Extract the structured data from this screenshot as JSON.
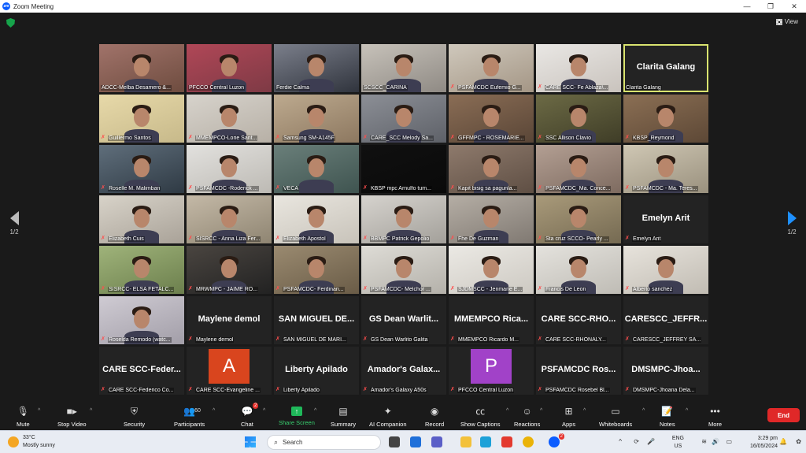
{
  "window": {
    "title": "Zoom Meeting",
    "minimize": "—",
    "maximize": "❐",
    "close": "✕"
  },
  "topbar": {
    "view_label": "View"
  },
  "pager": {
    "left": "1/2",
    "right": "1/2"
  },
  "tiles": [
    {
      "name": "ADCC-Melba Desamero &...",
      "kind": "video",
      "muted": false,
      "colors": [
        "#a1736a",
        "#6e4c3f"
      ]
    },
    {
      "name": "PFCCO Central Luzon",
      "kind": "video",
      "muted": false,
      "colors": [
        "#b04757",
        "#7e3a45"
      ]
    },
    {
      "name": "Ferdie Calma",
      "kind": "video",
      "muted": false,
      "colors": [
        "#7b7f8b",
        "#30343d"
      ]
    },
    {
      "name": "SCSCC_CARINA",
      "kind": "video",
      "muted": false,
      "colors": [
        "#c7c2ba",
        "#8f8a84"
      ]
    },
    {
      "name": "PSFAMCDC Eufemio G...",
      "kind": "video",
      "muted": true,
      "colors": [
        "#cfc8bc",
        "#a49685"
      ]
    },
    {
      "name": "CARE SCC- Fe Ablaza\\...",
      "kind": "video",
      "muted": true,
      "colors": [
        "#e9e7e4",
        "#c9c3bd"
      ]
    },
    {
      "name": "Clarita Galang",
      "kind": "name",
      "muted": false,
      "active": true
    },
    {
      "name": "Guillermo Santos",
      "kind": "video",
      "muted": true,
      "colors": [
        "#e7d9a9",
        "#c7b98a"
      ]
    },
    {
      "name": "MMEMPCO-Lorie Sant...",
      "kind": "video",
      "muted": true,
      "colors": [
        "#d7d3cc",
        "#b7b0a6"
      ]
    },
    {
      "name": "Samsung SM-A145F",
      "kind": "video",
      "muted": true,
      "colors": [
        "#bdaa8f",
        "#8d7860"
      ]
    },
    {
      "name": "CARE_SCC Melody Sa...",
      "kind": "video",
      "muted": true,
      "colors": [
        "#8c8f96",
        "#5e6168"
      ]
    },
    {
      "name": "GFFMPC - ROSEMARIE...",
      "kind": "video",
      "muted": true,
      "colors": [
        "#8a6d55",
        "#5a4637"
      ]
    },
    {
      "name": "SSC Allison Clavio",
      "kind": "video",
      "muted": true,
      "colors": [
        "#6c6a45",
        "#3f3d27"
      ]
    },
    {
      "name": "KBSP_Reymond",
      "kind": "video",
      "muted": true,
      "colors": [
        "#8b6f54",
        "#5d4836"
      ]
    },
    {
      "name": "Roselle M. Malimban",
      "kind": "video",
      "muted": true,
      "colors": [
        "#5f6e7b",
        "#2f3a44"
      ]
    },
    {
      "name": "PSFAMCDC -Roderick ...",
      "kind": "video",
      "muted": true,
      "colors": [
        "#e2e1de",
        "#bdbab4"
      ]
    },
    {
      "name": "VECA",
      "kind": "video",
      "muted": true,
      "colors": [
        "#6a7f7a",
        "#3f5450"
      ]
    },
    {
      "name": "KBSP mpc Arnulfo tum...",
      "kind": "video",
      "muted": true,
      "colors": [
        "#101010",
        "#0a0a0a"
      ]
    },
    {
      "name": "Kapit bisig sa pagunlа...",
      "kind": "video",
      "muted": true,
      "colors": [
        "#8e7a6c",
        "#5f4f44"
      ]
    },
    {
      "name": "PSFAMCDC_Ma. Conce...",
      "kind": "video",
      "muted": true,
      "colors": [
        "#b39f93",
        "#7e6b60"
      ]
    },
    {
      "name": "PSFAMCDC - Ma. Teres...",
      "kind": "video",
      "muted": true,
      "colors": [
        "#cfc7b4",
        "#9a917e"
      ]
    },
    {
      "name": "Elizabeth Cuis",
      "kind": "video",
      "muted": true,
      "colors": [
        "#d8d3c9",
        "#a9a298"
      ]
    },
    {
      "name": "SISRCC - Anna Liza Fer...",
      "kind": "video",
      "muted": true,
      "colors": [
        "#c4b9a7",
        "#8f8572"
      ]
    },
    {
      "name": "Elizabeth Apostol",
      "kind": "video",
      "muted": true,
      "colors": [
        "#e9e6df",
        "#c8c3ba"
      ]
    },
    {
      "name": "BBMPC Patrick Gepolio",
      "kind": "video",
      "muted": true,
      "colors": [
        "#d6d3ce",
        "#a3a09a"
      ]
    },
    {
      "name": "Fhe De Guzman",
      "kind": "video",
      "muted": true,
      "colors": [
        "#b5aea5",
        "#807972"
      ]
    },
    {
      "name": "Sta cruz SCCO- Pearly ...",
      "kind": "video",
      "muted": true,
      "colors": [
        "#a99a7a",
        "#756a52"
      ]
    },
    {
      "name": "Emelyn Arit",
      "kind": "name",
      "muted": true
    },
    {
      "name": "SISRCC- ELSA FETALC...",
      "kind": "video",
      "muted": true,
      "colors": [
        "#9fb37a",
        "#6c7f4d"
      ]
    },
    {
      "name": "MRWMPC - JAIME RO...",
      "kind": "video",
      "muted": true,
      "colors": [
        "#4a4540",
        "#222"
      ]
    },
    {
      "name": "PSFAMCDC- Ferdinan...",
      "kind": "video",
      "muted": true,
      "colors": [
        "#9a8a70",
        "#6a5c47"
      ]
    },
    {
      "name": "PSFAMCDC- Melchor ...",
      "kind": "video",
      "muted": true,
      "colors": [
        "#dedcd6",
        "#b4b1aa"
      ]
    },
    {
      "name": "SJDMSCC - Jenmarie E...",
      "kind": "video",
      "muted": true,
      "colors": [
        "#ebe9e4",
        "#cdc9c2"
      ]
    },
    {
      "name": "Francis De Leon",
      "kind": "video",
      "muted": true,
      "colors": [
        "#e4e2dd",
        "#bfbcb5"
      ]
    },
    {
      "name": "Alberto sanchez",
      "kind": "video",
      "muted": true,
      "colors": [
        "#e7e3dc",
        "#c1bcb3"
      ]
    },
    {
      "name": "Roselda Remodo (watc...",
      "kind": "video",
      "muted": true,
      "colors": [
        "#cfcbd3",
        "#a29ea8"
      ]
    },
    {
      "name": "Maylene demol",
      "kind": "name",
      "muted": true,
      "big": "Maylene demol"
    },
    {
      "name": "SAN MIGUEL DE MARI...",
      "kind": "name",
      "muted": true,
      "big": "SAN MIGUEL DE..."
    },
    {
      "name": "GS Dean Warlito Galita",
      "kind": "name",
      "muted": true,
      "big": "GS Dean Warlit..."
    },
    {
      "name": "MMEMPCO Ricardo M...",
      "kind": "name",
      "muted": true,
      "big": "MMEMPCO Rica..."
    },
    {
      "name": "CARE SCC-RHONALY...",
      "kind": "name",
      "muted": true,
      "big": "CARE SCC-RHO..."
    },
    {
      "name": "CARESCC_JEFFREY SA...",
      "kind": "name",
      "muted": true,
      "big": "CARESCC_JEFFR..."
    },
    {
      "name": "CARE SCC-Federico Co...",
      "kind": "name",
      "muted": true,
      "big": "CARE SCC-Feder..."
    },
    {
      "name": "CARE SCC-Evangeline ...",
      "kind": "avatar",
      "muted": true,
      "letter": "A",
      "color": "#d9451e"
    },
    {
      "name": "Liberty Apilado",
      "kind": "name",
      "muted": true,
      "big": "Liberty Apilado"
    },
    {
      "name": "Amador's Galaxy A50s",
      "kind": "name",
      "muted": true,
      "big": "Amador's Galax..."
    },
    {
      "name": "PFCCO Central Luzon",
      "kind": "avatar",
      "muted": true,
      "letter": "P",
      "color": "#a142c8"
    },
    {
      "name": "PSFAMCDC Rosebel Bl...",
      "kind": "name",
      "muted": true,
      "big": "PSFAMCDC Ros..."
    },
    {
      "name": "DMSMPC-Jhoana Dela...",
      "kind": "name",
      "muted": true,
      "big": "DMSMPC-Jhoa..."
    }
  ],
  "toolbar": {
    "mute": "Mute",
    "stop_video": "Stop Video",
    "security": "Security",
    "participants": "Participants",
    "participants_count": "60",
    "chat": "Chat",
    "chat_badge": "2",
    "share": "Share Screen",
    "summary": "Summary",
    "ai": "AI Companion",
    "record": "Record",
    "captions": "Show Captions",
    "reactions": "Reactions",
    "apps": "Apps",
    "whiteboards": "Whiteboards",
    "notes": "Notes",
    "more": "More",
    "end": "End"
  },
  "taskbar": {
    "temp": "33°C",
    "weather": "Mostly sunny",
    "search_placeholder": "Search",
    "lang1": "ENG",
    "lang2": "US",
    "time": "3:29 pm",
    "date": "16/05/2024",
    "zoom_badge": "2"
  }
}
